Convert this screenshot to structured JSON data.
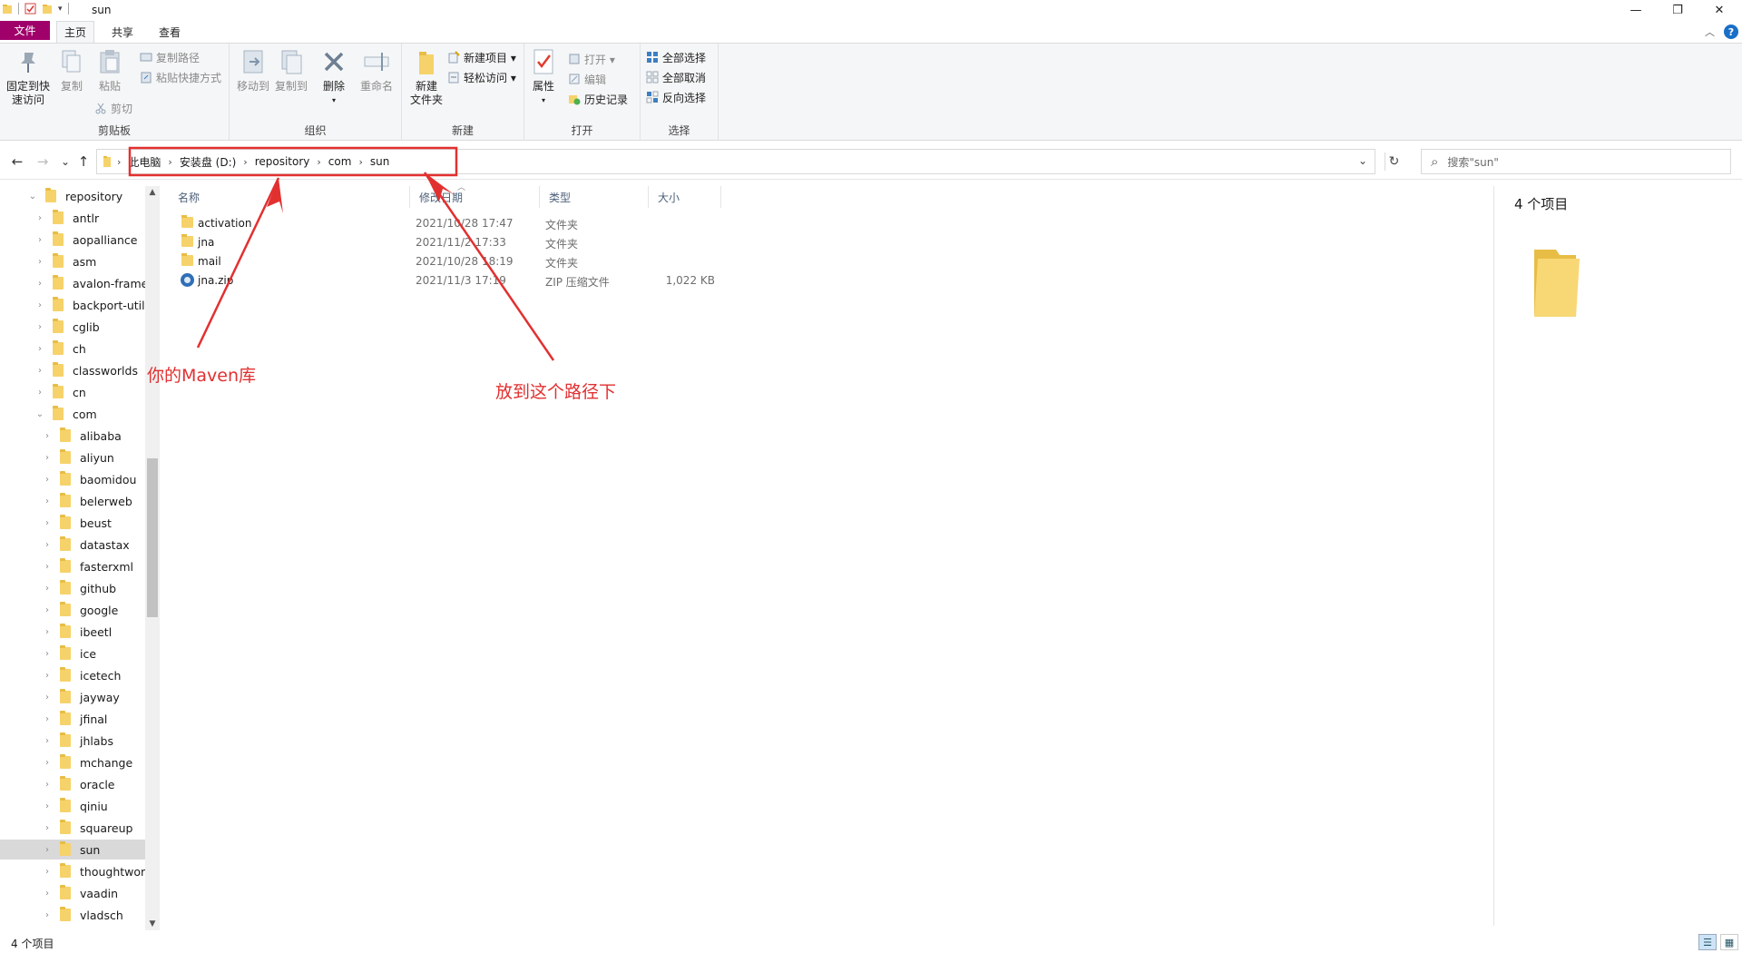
{
  "window": {
    "title": "sun",
    "minimize_glyph": "—",
    "maximize_glyph": "❐",
    "close_glyph": "✕"
  },
  "tabs": {
    "file": "文件",
    "home": "主页",
    "share": "共享",
    "view": "查看",
    "collapse_glyph": "︿",
    "help_glyph": "?"
  },
  "ribbon": {
    "clipboard": {
      "label": "剪贴板",
      "pin_line1": "固定到快",
      "pin_line2": "速访问",
      "copy": "复制",
      "paste": "粘贴",
      "copy_path": "复制路径",
      "paste_shortcut": "粘贴快捷方式",
      "cut": "剪切"
    },
    "organize": {
      "label": "组织",
      "move_to": "移动到",
      "copy_to": "复制到",
      "delete": "删除",
      "rename": "重命名"
    },
    "new": {
      "label": "新建",
      "new_folder_line1": "新建",
      "new_folder_line2": "文件夹",
      "new_item": "新建项目 ▾",
      "easy_access": "轻松访问 ▾"
    },
    "open": {
      "label": "打开",
      "properties": "属性",
      "open": "打开 ▾",
      "edit": "编辑",
      "history": "历史记录"
    },
    "select": {
      "label": "选择",
      "select_all": "全部选择",
      "select_none": "全部取消",
      "invert": "反向选择"
    }
  },
  "nav": {
    "back_glyph": "←",
    "forward_glyph": "→",
    "recent_glyph": "⌄",
    "up_glyph": "↑",
    "refresh_glyph": "↻",
    "breadcrumbs": [
      "此电脑",
      "安装盘 (D:)",
      "repository",
      "com",
      "sun"
    ],
    "crumb_sep": "›",
    "search_placeholder": "搜索\"sun\"",
    "search_glyph": "⌕"
  },
  "tree": {
    "items": [
      {
        "label": "repository",
        "level": 0,
        "expanded": true
      },
      {
        "label": "antlr",
        "level": 1
      },
      {
        "label": "aopalliance",
        "level": 1
      },
      {
        "label": "asm",
        "level": 1
      },
      {
        "label": "avalon-framew",
        "level": 1
      },
      {
        "label": "backport-util-c",
        "level": 1
      },
      {
        "label": "cglib",
        "level": 1
      },
      {
        "label": "ch",
        "level": 1
      },
      {
        "label": "classworlds",
        "level": 1
      },
      {
        "label": "cn",
        "level": 1
      },
      {
        "label": "com",
        "level": 1,
        "expanded": true
      },
      {
        "label": "alibaba",
        "level": 2
      },
      {
        "label": "aliyun",
        "level": 2
      },
      {
        "label": "baomidou",
        "level": 2
      },
      {
        "label": "belerweb",
        "level": 2
      },
      {
        "label": "beust",
        "level": 2
      },
      {
        "label": "datastax",
        "level": 2
      },
      {
        "label": "fasterxml",
        "level": 2
      },
      {
        "label": "github",
        "level": 2
      },
      {
        "label": "google",
        "level": 2
      },
      {
        "label": "ibeetl",
        "level": 2
      },
      {
        "label": "ice",
        "level": 2
      },
      {
        "label": "icetech",
        "level": 2
      },
      {
        "label": "jayway",
        "level": 2
      },
      {
        "label": "jfinal",
        "level": 2
      },
      {
        "label": "jhlabs",
        "level": 2
      },
      {
        "label": "mchange",
        "level": 2
      },
      {
        "label": "oracle",
        "level": 2
      },
      {
        "label": "qiniu",
        "level": 2
      },
      {
        "label": "squareup",
        "level": 2
      },
      {
        "label": "sun",
        "level": 2,
        "selected": true
      },
      {
        "label": "thoughtwork",
        "level": 2
      },
      {
        "label": "vaadin",
        "level": 2
      },
      {
        "label": "vladsch",
        "level": 2
      }
    ]
  },
  "filelist": {
    "columns": {
      "name": "名称",
      "date": "修改日期",
      "type": "类型",
      "size": "大小"
    },
    "rows": [
      {
        "name": "activation",
        "date": "2021/10/28 17:47",
        "type": "文件夹",
        "size": "",
        "kind": "folder"
      },
      {
        "name": "jna",
        "date": "2021/11/2 17:33",
        "type": "文件夹",
        "size": "",
        "kind": "folder"
      },
      {
        "name": "mail",
        "date": "2021/10/28 18:19",
        "type": "文件夹",
        "size": "",
        "kind": "folder"
      },
      {
        "name": "jna.zip",
        "date": "2021/11/3 17:19",
        "type": "ZIP 压缩文件",
        "size": "1,022 KB",
        "kind": "zip"
      }
    ]
  },
  "preview": {
    "count": "4 个项目"
  },
  "status": {
    "count": "4 个项目"
  },
  "annotations": {
    "left": "你的Maven库",
    "right": "放到这个路径下"
  },
  "colors": {
    "file_tab": "#a0006a",
    "annotation": "#e23030",
    "selection": "#d9d9d9"
  }
}
